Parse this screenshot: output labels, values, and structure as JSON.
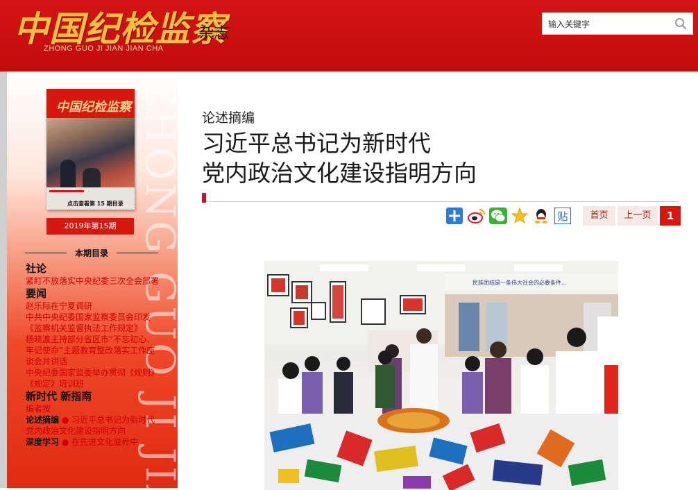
{
  "header": {
    "logo_cn": "中国纪检监察",
    "logo_en": "ZHONG GUO JI JIAN JIAN CHA",
    "logo_suffix": "杂志",
    "search_placeholder": "输入关键字",
    "search_icon": "magnifier-icon"
  },
  "sidebar": {
    "watermark": "ZHONG GUO JI JIAN",
    "cover": {
      "title": "中国纪检监察",
      "caption": "点击查看第 15 期目录"
    },
    "issue_label": "2019年第15期",
    "toc_title": "本期目录",
    "toc": [
      {
        "type": "cat",
        "text": "社论"
      },
      {
        "type": "item",
        "text": "紧盯不放落实中央纪委三次全会部署"
      },
      {
        "type": "cat",
        "text": "要闻"
      },
      {
        "type": "item",
        "text": "赵乐际在宁夏调研"
      },
      {
        "type": "item",
        "text": "中共中央纪委国家监察委员会印发《监察机关监督执法工作规定》"
      },
      {
        "type": "item",
        "text": "杨晓渡主持部分省区市“不忘初心、牢记使命”主题教育整改落实工作座谈会并讲话"
      },
      {
        "type": "item",
        "text": "中央纪委国家监委举办贯彻《规则》《规定》培训班"
      },
      {
        "type": "cat",
        "text": "新时代 新指南"
      },
      {
        "type": "item",
        "text": "编者按"
      },
      {
        "type": "item",
        "prefix": "论述摘编",
        "text": "● 习近平总书记为新时代党内政治文化建设指明方向"
      },
      {
        "type": "item",
        "prefix": "深度学习",
        "text": "● 在先进文化滋养中"
      }
    ]
  },
  "main": {
    "section": "论述摘编",
    "title_line1": "习近平总书记为新时代",
    "title_line2": "党内政治文化建设指明方向",
    "share_icons": [
      "plus-share-icon",
      "weibo-icon",
      "wechat-icon",
      "qzone-star-icon",
      "qq-icon",
      "tieba-icon"
    ],
    "pager": {
      "first": "首页",
      "prev": "上一页",
      "current": "1"
    },
    "photo_banner": "民族团结是一条伟大社会的必要条件...",
    "colors": {
      "brand_red": "#d8170f",
      "gold": "#f2c040"
    }
  }
}
